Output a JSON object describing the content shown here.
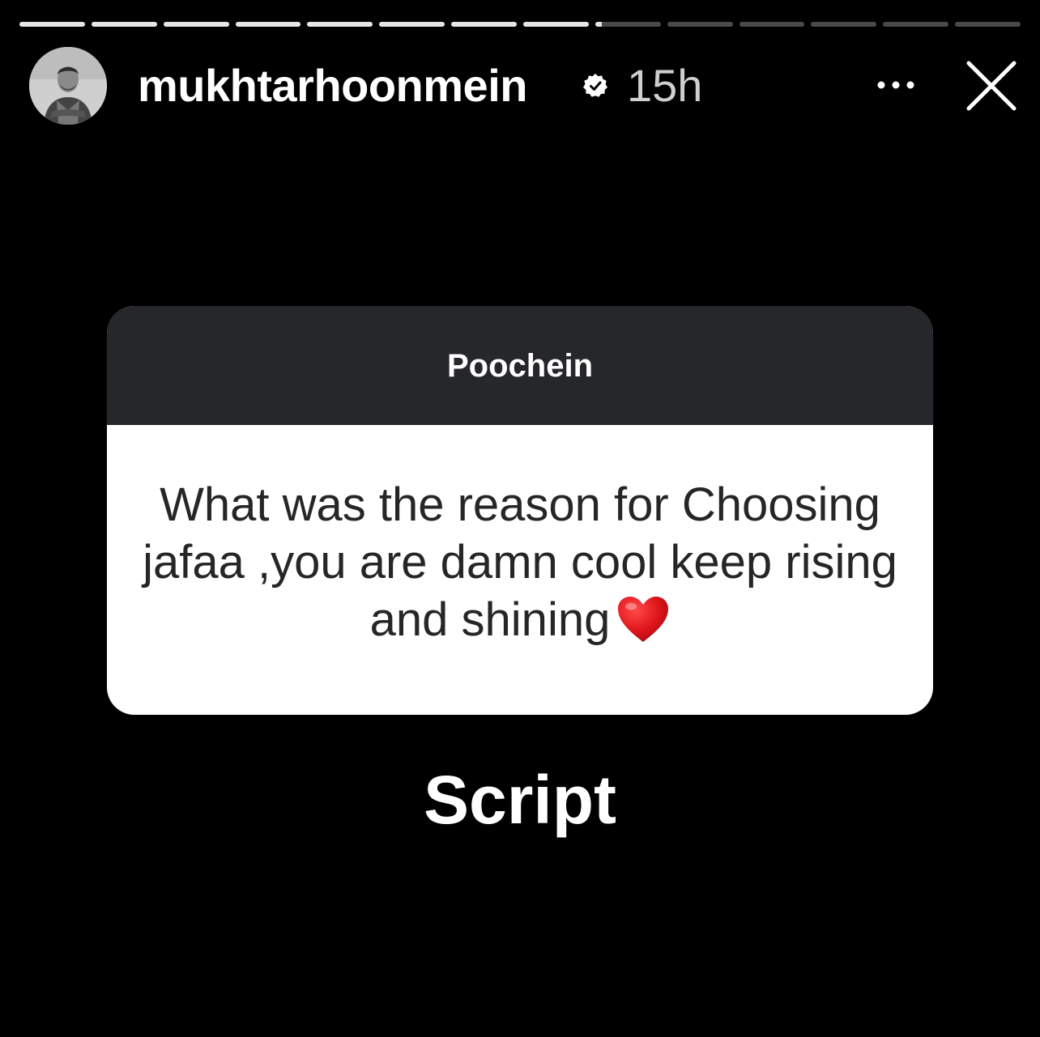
{
  "story": {
    "progress_segments": [
      1,
      1,
      1,
      1,
      1,
      1,
      1,
      1,
      0.1,
      0,
      0,
      0,
      0,
      0
    ],
    "username": "mukhtarhoonmein",
    "verified": true,
    "time_ago": "15h",
    "icons": {
      "verified": "verified-badge-icon",
      "more": "more-options-icon",
      "close": "close-icon",
      "heart": "red-heart-emoji"
    }
  },
  "question_card": {
    "title": "Poochein",
    "question": "What was the reason for Choosing jafaa ,you are damn cool keep rising and shining",
    "header_color": "#26272b",
    "text_color": "#262626"
  },
  "reply": {
    "text": "Script"
  },
  "colors": {
    "background": "#000000",
    "heart": "#e0161c"
  }
}
